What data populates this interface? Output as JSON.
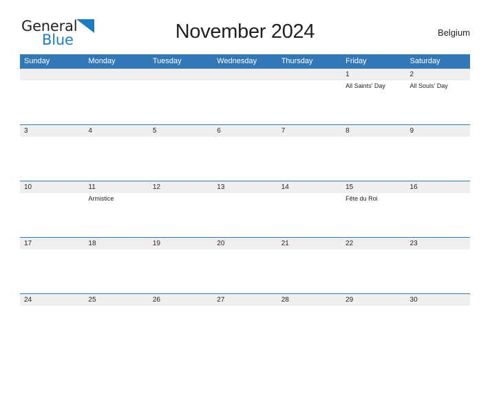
{
  "brand": {
    "name_part1": "General",
    "name_part2": "Blue",
    "flag_icon": "blue-triangle-flag-icon",
    "color_dark": "#231f20",
    "color_blue": "#1f7ac4"
  },
  "header": {
    "title": "November 2024",
    "region": "Belgium"
  },
  "calendar": {
    "header_bg": "#3277b6",
    "day_band_bg": "#efefef",
    "separator_color": "#3277b6",
    "weekday_headers": [
      "Sunday",
      "Monday",
      "Tuesday",
      "Wednesday",
      "Thursday",
      "Friday",
      "Saturday"
    ],
    "weeks": [
      [
        {
          "date": "",
          "event": ""
        },
        {
          "date": "",
          "event": ""
        },
        {
          "date": "",
          "event": ""
        },
        {
          "date": "",
          "event": ""
        },
        {
          "date": "",
          "event": ""
        },
        {
          "date": "1",
          "event": "All Saints' Day"
        },
        {
          "date": "2",
          "event": "All Souls' Day"
        }
      ],
      [
        {
          "date": "3",
          "event": ""
        },
        {
          "date": "4",
          "event": ""
        },
        {
          "date": "5",
          "event": ""
        },
        {
          "date": "6",
          "event": ""
        },
        {
          "date": "7",
          "event": ""
        },
        {
          "date": "8",
          "event": ""
        },
        {
          "date": "9",
          "event": ""
        }
      ],
      [
        {
          "date": "10",
          "event": ""
        },
        {
          "date": "11",
          "event": "Armistice"
        },
        {
          "date": "12",
          "event": ""
        },
        {
          "date": "13",
          "event": ""
        },
        {
          "date": "14",
          "event": ""
        },
        {
          "date": "15",
          "event": "Fête du Roi"
        },
        {
          "date": "16",
          "event": ""
        }
      ],
      [
        {
          "date": "17",
          "event": ""
        },
        {
          "date": "18",
          "event": ""
        },
        {
          "date": "19",
          "event": ""
        },
        {
          "date": "20",
          "event": ""
        },
        {
          "date": "21",
          "event": ""
        },
        {
          "date": "22",
          "event": ""
        },
        {
          "date": "23",
          "event": ""
        }
      ],
      [
        {
          "date": "24",
          "event": ""
        },
        {
          "date": "25",
          "event": ""
        },
        {
          "date": "26",
          "event": ""
        },
        {
          "date": "27",
          "event": ""
        },
        {
          "date": "28",
          "event": ""
        },
        {
          "date": "29",
          "event": ""
        },
        {
          "date": "30",
          "event": ""
        }
      ]
    ]
  }
}
